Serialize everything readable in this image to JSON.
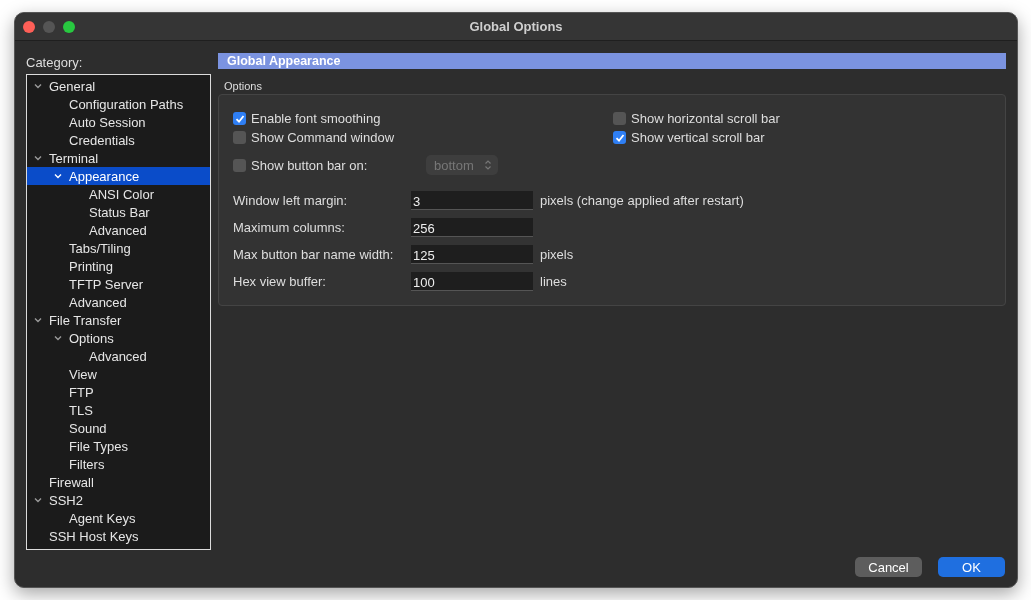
{
  "window": {
    "title": "Global Options"
  },
  "category": {
    "label": "Category:",
    "tree": [
      {
        "label": "General",
        "expanded": true,
        "selected": false,
        "children": [
          {
            "label": "Configuration Paths",
            "selected": false
          },
          {
            "label": "Auto Session",
            "selected": false
          },
          {
            "label": "Credentials",
            "selected": false
          }
        ]
      },
      {
        "label": "Terminal",
        "expanded": true,
        "selected": false,
        "children": [
          {
            "label": "Appearance",
            "expanded": true,
            "selected": true,
            "children": [
              {
                "label": "ANSI Color",
                "selected": false
              },
              {
                "label": "Status Bar",
                "selected": false
              },
              {
                "label": "Advanced",
                "selected": false
              }
            ]
          },
          {
            "label": "Tabs/Tiling",
            "selected": false
          },
          {
            "label": "Printing",
            "selected": false
          },
          {
            "label": "TFTP Server",
            "selected": false
          },
          {
            "label": "Advanced",
            "selected": false
          }
        ]
      },
      {
        "label": "File Transfer",
        "expanded": true,
        "selected": false,
        "children": [
          {
            "label": "Options",
            "expanded": true,
            "selected": false,
            "children": [
              {
                "label": "Advanced",
                "selected": false
              }
            ]
          },
          {
            "label": "View",
            "selected": false
          },
          {
            "label": "FTP",
            "selected": false
          },
          {
            "label": "TLS",
            "selected": false
          },
          {
            "label": "Sound",
            "selected": false
          },
          {
            "label": "File Types",
            "selected": false
          },
          {
            "label": "Filters",
            "selected": false
          }
        ]
      },
      {
        "label": "Firewall",
        "selected": false
      },
      {
        "label": "SSH2",
        "expanded": true,
        "selected": false,
        "children": [
          {
            "label": "Agent Keys",
            "selected": false
          }
        ]
      },
      {
        "label": "SSH Host Keys",
        "selected": false
      }
    ]
  },
  "panel": {
    "title": "Global Appearance",
    "group_label": "Options",
    "checkboxes_left": [
      {
        "label": "Enable font smoothing",
        "checked": true
      },
      {
        "label": "Show Command window",
        "checked": false
      }
    ],
    "checkboxes_right": [
      {
        "label": "Show horizontal scroll bar",
        "checked": false
      },
      {
        "label": "Show vertical scroll bar",
        "checked": true
      }
    ],
    "button_bar": {
      "label": "Show button bar on:",
      "checked": false,
      "value": "bottom",
      "disabled": true
    },
    "fields": [
      {
        "label": "Window left margin:",
        "value": "3",
        "unit": "pixels (change applied after restart)"
      },
      {
        "label": "Maximum columns:",
        "value": "256"
      },
      {
        "label": "Max button bar name width:",
        "value": "125",
        "unit": "pixels"
      },
      {
        "label": "Hex view buffer:",
        "value": "100",
        "unit": "lines"
      }
    ]
  },
  "buttons": [
    {
      "label": "Cancel",
      "kind": "secondary"
    },
    {
      "label": "OK",
      "kind": "primary"
    }
  ]
}
